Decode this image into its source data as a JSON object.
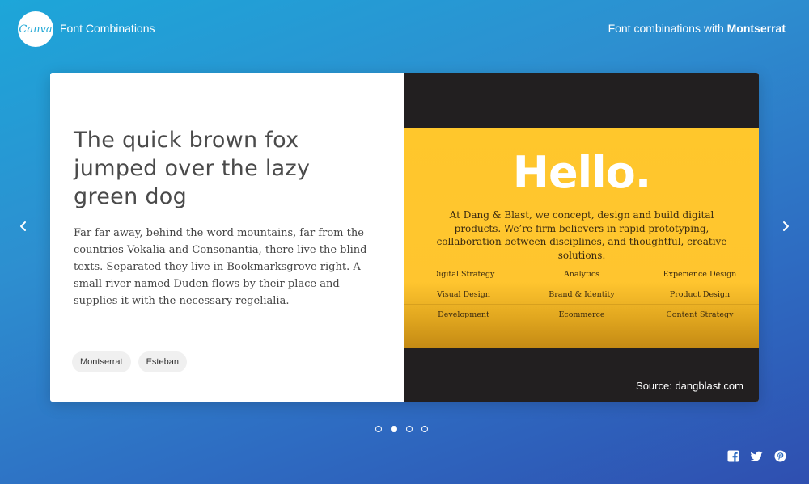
{
  "header": {
    "logo_text": "Canva",
    "app_title": "Font Combinations",
    "right_prefix": "Font combinations with ",
    "right_font": "Montserrat"
  },
  "card": {
    "headline": "The quick brown fox jumped over the lazy green dog",
    "body": "Far far away, behind the word mountains, far from the countries Vokalia and Consonantia, there live the blind texts. Separated they live in Bookmarksgrove right. A small river named Duden flows by their place and supplies it with the necessary regelialia.",
    "tags": [
      "Montserrat",
      "Esteban"
    ]
  },
  "preview": {
    "hello": "Hello.",
    "intro": "At Dang & Blast, we concept, design and build digital products. We’re firm believers in rapid prototyping, collaboration between disciplines, and thoughtful, creative solutions.",
    "services": [
      [
        "Digital Strategy",
        "Analytics",
        "Experience Design"
      ],
      [
        "Visual Design",
        "Brand & Identity",
        "Product Design"
      ],
      [
        "Development",
        "Ecommerce",
        "Content Strategy"
      ]
    ],
    "source": "Source: dangblast.com",
    "accent_color": "#ffc72c"
  },
  "carousel": {
    "slide_count": 4,
    "active_index": 1
  },
  "icons": {
    "prev": "chevron-left-icon",
    "next": "chevron-right-icon",
    "socials": [
      "facebook-icon",
      "twitter-icon",
      "pinterest-icon"
    ]
  }
}
